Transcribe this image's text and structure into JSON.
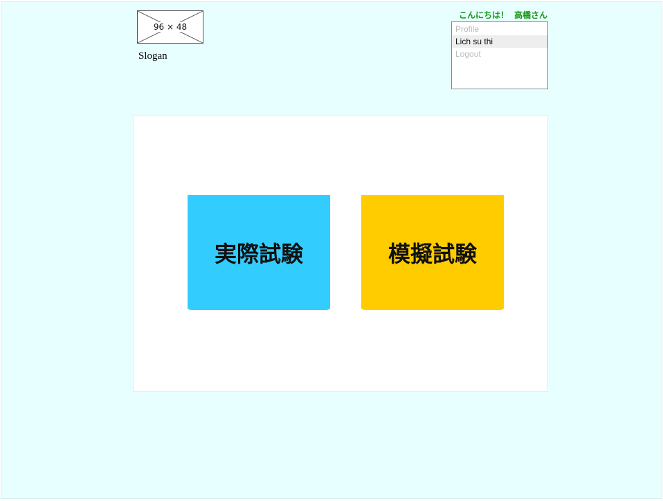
{
  "header": {
    "logo_placeholder": "96 × 48",
    "slogan": "Slogan"
  },
  "user": {
    "greeting": "こんにちは！",
    "name": "高橋さん"
  },
  "user_menu": {
    "items": [
      {
        "label": "Profile",
        "state": "disabled"
      },
      {
        "label": "Lich su thi",
        "state": "hover"
      },
      {
        "label": "Logout",
        "state": "disabled"
      }
    ]
  },
  "main": {
    "tiles": [
      {
        "label": "実際試験",
        "color": "#33ccff"
      },
      {
        "label": "模擬試験",
        "color": "#ffcc00"
      }
    ]
  },
  "colors": {
    "page_background": "#e8ffff",
    "greeting_text": "#1a9a1a"
  }
}
